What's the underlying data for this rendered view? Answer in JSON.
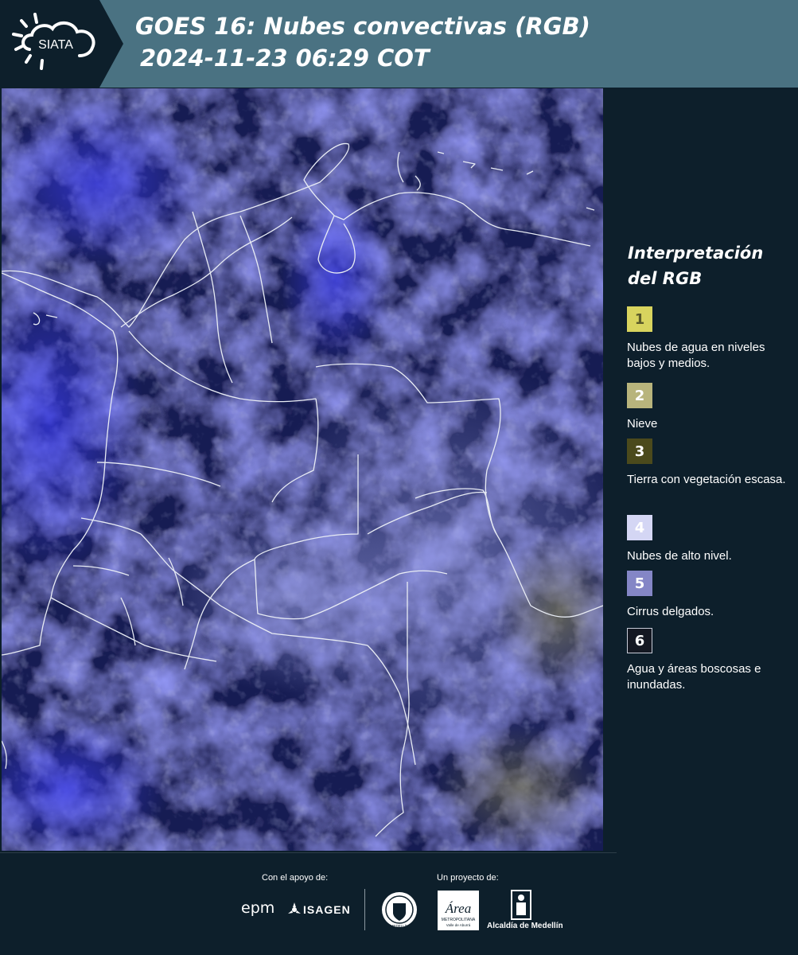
{
  "header": {
    "logo_text": "SIATA",
    "title_line1": "GOES 16: Nubes convectivas (RGB)",
    "title_line2": "2024-11-23 06:29 COT",
    "background_color": "#4a7282"
  },
  "legend": {
    "title_line1": "Interpretación",
    "title_line2": "del RGB",
    "items": [
      {
        "number": "1",
        "label": "Nubes de agua en niveles bajos y medios.",
        "color": "#d8d45e",
        "text_color": "#5a5a2a"
      },
      {
        "number": "2",
        "label": "Nieve",
        "color": "#b8b47c",
        "text_color": "#ffffff"
      },
      {
        "number": "3",
        "label": "Tierra con vegetación escasa.",
        "color": "#4b4a1c",
        "text_color": "#ffffff"
      },
      {
        "number": "4",
        "label": "Nubes de alto nivel.",
        "color": "#d4d6f4",
        "text_color": "#ffffff"
      },
      {
        "number": "5",
        "label": "Cirrus delgados.",
        "color": "#8486c6",
        "text_color": "#ffffff"
      },
      {
        "number": "6",
        "label": "Agua y áreas boscosas e inundadas.",
        "color": "#141822",
        "text_color": "#ffffff"
      }
    ]
  },
  "footer": {
    "support_label": "Con el apoyo de:",
    "project_label": "Un proyecto de:",
    "sponsors": [
      "epm",
      "ISAGEN"
    ],
    "partners": [
      "MEDELLÍN",
      "Área Metropolitana Valle de Aburrá",
      "Alcaldía de Medellín"
    ],
    "area_text": "Área",
    "area_sub1": "METROPOLITANA",
    "area_sub2": "Valle de Aburrá",
    "alcaldia_text": "Alcaldía de Medellín",
    "seal_text": "MEDELLÍN"
  },
  "map": {
    "image": "satellite-rgb-composite",
    "region": "Colombia"
  }
}
